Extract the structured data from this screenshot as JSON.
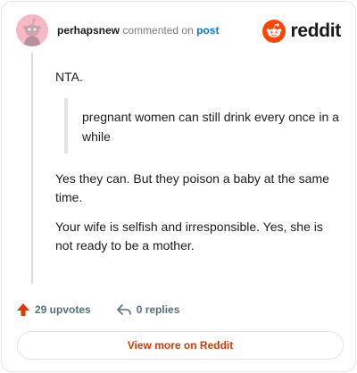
{
  "header": {
    "username": "perhapsnew",
    "action_text": "commented on",
    "post_link": "post",
    "brand": "reddit"
  },
  "comment": {
    "intro": "NTA.",
    "quote": "pregnant women can still drink every once in a while",
    "paragraphs": [
      "Yes they can. But they poison a baby at the same time.",
      "Your wife is selfish and irresponsible. Yes, she is not ready to be a mother."
    ]
  },
  "actions": {
    "upvotes": "29 upvotes",
    "replies": "0 replies"
  },
  "footer": {
    "view_more": "View more on Reddit"
  },
  "colors": {
    "accent": "#d93a00",
    "brand_orange": "#ff4500",
    "link": "#0079d3"
  }
}
